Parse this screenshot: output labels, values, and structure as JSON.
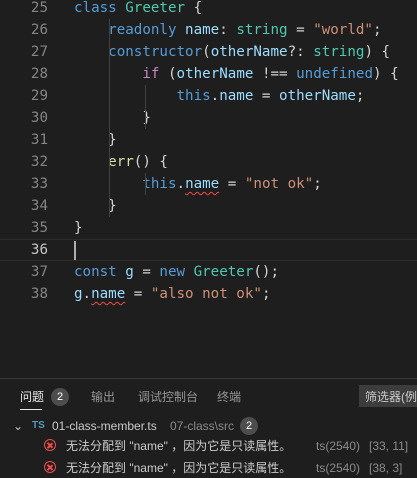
{
  "editor": {
    "lines": [
      {
        "num": "25",
        "tokens": [
          {
            "t": "class ",
            "c": "kw"
          },
          {
            "t": "Greeter",
            "c": "cls"
          },
          {
            "t": " {",
            "c": ""
          }
        ]
      },
      {
        "num": "26",
        "tokens": [
          {
            "t": "    ",
            "c": ""
          },
          {
            "t": "readonly ",
            "c": "kw"
          },
          {
            "t": "name",
            "c": "prop"
          },
          {
            "t": ": ",
            "c": ""
          },
          {
            "t": "string",
            "c": "cls"
          },
          {
            "t": " = ",
            "c": ""
          },
          {
            "t": "\"world\"",
            "c": "str"
          },
          {
            "t": ";",
            "c": ""
          }
        ]
      },
      {
        "num": "27",
        "tokens": [
          {
            "t": "    ",
            "c": ""
          },
          {
            "t": "constructor",
            "c": "kw"
          },
          {
            "t": "(",
            "c": ""
          },
          {
            "t": "otherName",
            "c": "prop"
          },
          {
            "t": "?: ",
            "c": ""
          },
          {
            "t": "string",
            "c": "cls"
          },
          {
            "t": ") {",
            "c": ""
          }
        ]
      },
      {
        "num": "28",
        "tokens": [
          {
            "t": "        ",
            "c": ""
          },
          {
            "t": "if",
            "c": "ctl"
          },
          {
            "t": " (",
            "c": ""
          },
          {
            "t": "otherName",
            "c": "prop"
          },
          {
            "t": " !== ",
            "c": ""
          },
          {
            "t": "undefined",
            "c": "kw"
          },
          {
            "t": ") {",
            "c": ""
          }
        ]
      },
      {
        "num": "29",
        "tokens": [
          {
            "t": "            ",
            "c": ""
          },
          {
            "t": "this",
            "c": "kw"
          },
          {
            "t": ".",
            "c": ""
          },
          {
            "t": "name",
            "c": "prop"
          },
          {
            "t": " = ",
            "c": ""
          },
          {
            "t": "otherName",
            "c": "prop"
          },
          {
            "t": ";",
            "c": ""
          }
        ]
      },
      {
        "num": "30",
        "tokens": [
          {
            "t": "        }",
            "c": ""
          }
        ]
      },
      {
        "num": "31",
        "tokens": [
          {
            "t": "    }",
            "c": ""
          }
        ]
      },
      {
        "num": "32",
        "tokens": [
          {
            "t": "    ",
            "c": ""
          },
          {
            "t": "err",
            "c": "fn"
          },
          {
            "t": "() {",
            "c": ""
          }
        ]
      },
      {
        "num": "33",
        "tokens": [
          {
            "t": "        ",
            "c": ""
          },
          {
            "t": "this",
            "c": "kw"
          },
          {
            "t": ".",
            "c": ""
          },
          {
            "t": "name",
            "c": "prop squig"
          },
          {
            "t": " = ",
            "c": ""
          },
          {
            "t": "\"not ok\"",
            "c": "str"
          },
          {
            "t": ";",
            "c": ""
          }
        ]
      },
      {
        "num": "34",
        "tokens": [
          {
            "t": "    }",
            "c": ""
          }
        ]
      },
      {
        "num": "35",
        "tokens": [
          {
            "t": "}",
            "c": ""
          }
        ]
      },
      {
        "num": "36",
        "tokens": []
      },
      {
        "num": "37",
        "tokens": [
          {
            "t": "const ",
            "c": "kw"
          },
          {
            "t": "g",
            "c": "prop"
          },
          {
            "t": " = ",
            "c": ""
          },
          {
            "t": "new ",
            "c": "kw"
          },
          {
            "t": "Greeter",
            "c": "cls"
          },
          {
            "t": "();",
            "c": ""
          }
        ]
      },
      {
        "num": "38",
        "tokens": [
          {
            "t": "g",
            "c": "prop"
          },
          {
            "t": ".",
            "c": ""
          },
          {
            "t": "name",
            "c": "prop squig"
          },
          {
            "t": " = ",
            "c": ""
          },
          {
            "t": "\"also not ok\"",
            "c": "str"
          },
          {
            "t": ";",
            "c": ""
          }
        ]
      }
    ],
    "active_line": "36"
  },
  "panel": {
    "tabs": [
      {
        "label": "问题",
        "badge": "2",
        "active": true
      },
      {
        "label": "输出"
      },
      {
        "label": "调试控制台"
      },
      {
        "label": "终端"
      }
    ],
    "filter_placeholder": "筛选器(例",
    "file": {
      "icon": "TS",
      "name": "01-class-member.ts",
      "path": "07-class\\src",
      "count": "2"
    },
    "problems": [
      {
        "message": "无法分配到 \"name\" ，因为它是只读属性。",
        "source": "ts(2540)",
        "position": "[33, 11]"
      },
      {
        "message": "无法分配到 \"name\" ，因为它是只读属性。",
        "source": "ts(2540)",
        "position": "[38, 3]"
      }
    ]
  },
  "colors": {
    "background": "#1e1e1e",
    "keyword": "#569cd6",
    "type": "#4ec9b0",
    "string": "#ce9178",
    "error": "#f14c4c"
  }
}
